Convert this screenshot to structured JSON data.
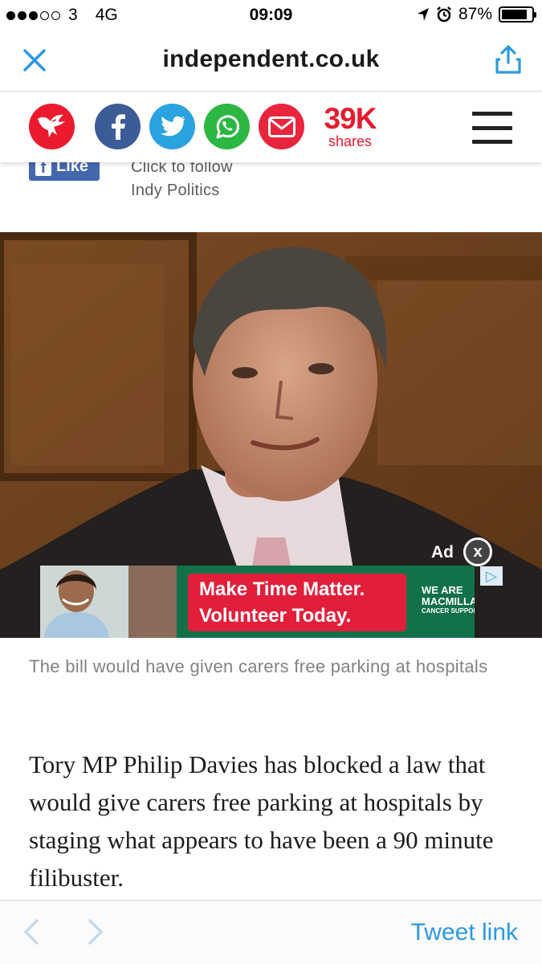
{
  "status_bar": {
    "carrier": "3",
    "network": "4G",
    "time": "09:09",
    "battery": "87%",
    "battery_level": 0.87,
    "signal_bars_filled": 3,
    "signal_bars_total": 5
  },
  "browser": {
    "url": "independent.co.uk",
    "close_icon": "close-icon",
    "share_icon": "share-icon"
  },
  "share_bar": {
    "shares_count": "39K",
    "shares_label": "shares",
    "buttons": [
      "independent-eagle-logo",
      "facebook-icon",
      "twitter-icon",
      "whatsapp-icon",
      "email-icon"
    ],
    "colors": {
      "logo": "#ec1a2e",
      "facebook": "#3b5c97",
      "twitter": "#2aa3de",
      "whatsapp": "#2cb742",
      "email": "#e9243d",
      "shares": "#e51b2f"
    }
  },
  "follow": {
    "like_label": "Like",
    "line1": "Click to follow",
    "line2": "Indy Politics"
  },
  "ad": {
    "label": "Ad",
    "close": "x",
    "headline_1": "Make Time Matter.",
    "headline_2": "Volunteer Today.",
    "brand_1": "WE ARE",
    "brand_2": "MACMILLAN.",
    "brand_3": "CANCER SUPPORT"
  },
  "article": {
    "caption": "The bill would have given carers free parking at hospitals",
    "body": "Tory MP Philip Davies has blocked a law that would give carers free parking at hospitals by staging what appears to have been a 90 minute filibuster."
  },
  "toolbar": {
    "tweet_link": "Tweet link",
    "link_color": "#2b99e2"
  }
}
